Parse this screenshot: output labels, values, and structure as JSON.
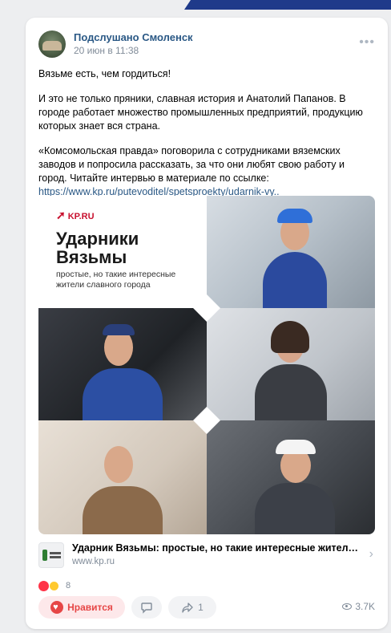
{
  "post": {
    "group_name": "Подслушано Смоленск",
    "date": "20 июн в 11:38",
    "paragraph1": "Вязьме есть, чем гордиться!",
    "paragraph2": "И это не только пряники, славная история и Анатолий Папанов. В городе работает множество промышленных предприятий, продукцию которых знает вся страна.",
    "paragraph3": "«Комсомольская правда» поговорила с сотрудниками вяземских заводов и попросила рассказать, за что они любят свою работу и город. Читайте интервью в материале по ссылке:",
    "link_text": "https://www.kp.ru/putevoditel/spetsproekty/udarnik-vy.."
  },
  "poster": {
    "logo": "KP.RU",
    "title_line1": "Ударники",
    "title_line2": "Вязьмы",
    "subtitle_line1": "простые, но такие интересные",
    "subtitle_line2": "жители славного города"
  },
  "snippet": {
    "title": "Ударник Вязьмы: простые, но такие интересные жители сла...",
    "domain": "www.kp.ru"
  },
  "reactions": {
    "count": "8"
  },
  "actions": {
    "like_label": "Нравится",
    "share_count": "1",
    "views": "3.7K"
  },
  "icons": [
    "more-icon",
    "like-heart-icon",
    "comment-icon",
    "share-icon",
    "eye-icon",
    "chevron-right-icon"
  ],
  "colors": {
    "accent": "#2a5885",
    "like": "#e64646",
    "kp_red": "#c8102e"
  }
}
